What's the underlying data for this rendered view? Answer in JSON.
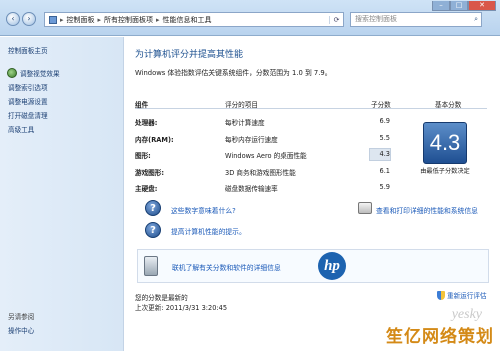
{
  "address_bar": {
    "crumbs": [
      "控制面板",
      "所有控制面板项",
      "性能信息和工具"
    ],
    "search_placeholder": "搜索控制面板"
  },
  "sidebar": {
    "home": "控制面板主页",
    "items": [
      "调整视觉效果",
      "调整索引选项",
      "调整电源设置",
      "打开磁盘清理",
      "高级工具"
    ],
    "see_also_title": "另请参阅",
    "see_also": [
      "操作中心"
    ]
  },
  "main": {
    "title": "为计算机评分并提高其性能",
    "intro": "Windows 体验指数评估关键系统组件，分数范围为 1.0 到 7.9。",
    "columns": {
      "component": "组件",
      "rated": "评分的项目",
      "subscore": "子分数",
      "base": "基本分数"
    },
    "rows": [
      {
        "component": "处理器:",
        "rated": "每秒计算速度",
        "subscore": "6.9"
      },
      {
        "component": "内存(RAM):",
        "rated": "每秒内存运行速度",
        "subscore": "5.5"
      },
      {
        "component": "图形:",
        "rated": "Windows Aero 的桌面性能",
        "subscore": "4.3"
      },
      {
        "component": "游戏图形:",
        "rated": "3D 商务和游戏图形性能",
        "subscore": "6.1"
      },
      {
        "component": "主硬盘:",
        "rated": "磁盘数据传输速率",
        "subscore": "5.9"
      }
    ],
    "base_score": "4.3",
    "base_note": "由最低子分数决定",
    "links": {
      "meaning": "这些数字意味着什么?",
      "tips": "提高计算机性能的提示。",
      "print": "查看和打印详细的性能和系统信息",
      "hp": "联机了解有关分数和软件的详细信息"
    },
    "footer": {
      "latest": "您的分数是最新的",
      "last_update": "上次更新: 2011/3/31 3:20:45",
      "rerun": "重新运行评估"
    },
    "watermark": "笙亿网络策划",
    "watermark_en": "yesky"
  },
  "colors": {
    "score_blue": "#2a5ea5",
    "link_blue": "#1a59b8"
  }
}
